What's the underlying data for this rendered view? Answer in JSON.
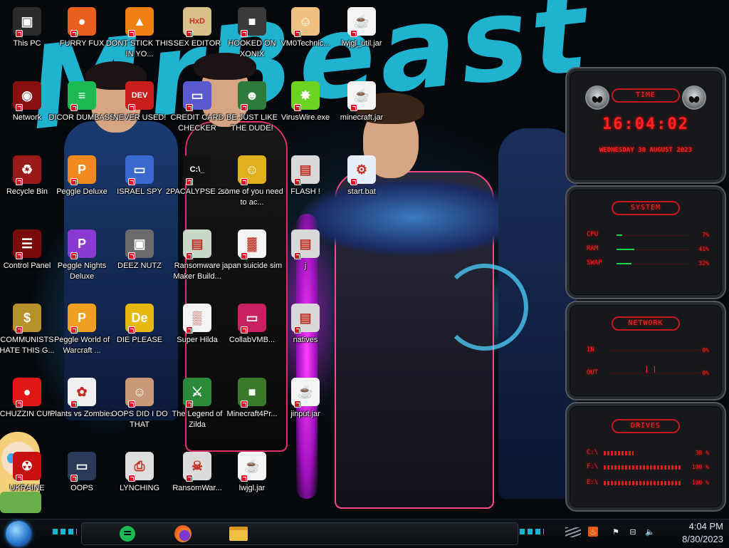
{
  "wallpaper": {
    "text": "MrBeast",
    "accent_color": "#22c6e6"
  },
  "desktop_icons": [
    {
      "label": "This PC",
      "icon": "this-pc-icon",
      "color": "#2a2a2a",
      "glyph": "▣"
    },
    {
      "label": "FURRY FUX",
      "icon": "firefox-icon",
      "color": "#e8601c",
      "glyph": "●"
    },
    {
      "label": "DONT STICK THIS IN YO...",
      "icon": "vlc-cone-icon",
      "color": "#f08010",
      "glyph": "▲"
    },
    {
      "label": "SEX EDITOR",
      "icon": "hxd-icon",
      "color": "#d9c08a",
      "glyph": "HxD"
    },
    {
      "label": "HOOKED ON XONIX",
      "icon": "xonix-icon",
      "color": "#3a3a3a",
      "glyph": "■"
    },
    {
      "label": "VM0Technic...",
      "icon": "doctor-icon",
      "color": "#f0c080",
      "glyph": "☺"
    },
    {
      "label": "lwjgl_util.jar",
      "icon": "java-jar-icon",
      "color": "#f4f4f4",
      "glyph": "☕"
    },
    {
      "label": "Network",
      "icon": "network-icon",
      "color": "#8a1010",
      "glyph": "◉"
    },
    {
      "label": "DICOR DUMBASS",
      "icon": "chat-icon",
      "color": "#1db954",
      "glyph": "≡"
    },
    {
      "label": "NEVER USED!",
      "icon": "devcpp-icon",
      "color": "#c81e1e",
      "glyph": "DEV"
    },
    {
      "label": "CREDIT CARD CHECKER",
      "icon": "credit-card-icon",
      "color": "#5a5ad0",
      "glyph": "▭"
    },
    {
      "label": "BE JUST LIKE THE DUDE!",
      "icon": "santa-icon",
      "color": "#2e7a3a",
      "glyph": "☻"
    },
    {
      "label": "VirusWire.exe",
      "icon": "lime-icon",
      "color": "#6ad420",
      "glyph": "✸"
    },
    {
      "label": "minecraft.jar",
      "icon": "java-jar-icon",
      "color": "#f4f4f4",
      "glyph": "☕"
    },
    {
      "label": "Recycle Bin",
      "icon": "recycle-bin-icon",
      "color": "#9a1a1a",
      "glyph": "♻"
    },
    {
      "label": "Peggle Deluxe",
      "icon": "peggle-icon",
      "color": "#f08a1e",
      "glyph": "P"
    },
    {
      "label": "ISRAEL SPY",
      "icon": "monitor-icon",
      "color": "#3a6ad0",
      "glyph": "▭"
    },
    {
      "label": "2PACALYPSE 2.3",
      "icon": "terminal-icon",
      "color": "#111111",
      "glyph": "C:\\_"
    },
    {
      "label": "some of you need to ac...",
      "icon": "beaver-icon",
      "color": "#e0b020",
      "glyph": "☺"
    },
    {
      "label": "FLASH !",
      "icon": "folder-icon",
      "color": "#d8d8d8",
      "glyph": "▤"
    },
    {
      "label": "start.bat",
      "icon": "batch-gear-icon",
      "color": "#e8eef8",
      "glyph": "⚙"
    },
    {
      "label": "Control Panel",
      "icon": "control-panel-icon",
      "color": "#7a0a0a",
      "glyph": "☰"
    },
    {
      "label": "Peggle Nights Deluxe",
      "icon": "peggle-icon",
      "color": "#8a3ad0",
      "glyph": "P"
    },
    {
      "label": "DEEZ NUTZ",
      "icon": "windows-stack-icon",
      "color": "#6a6a6a",
      "glyph": "▣"
    },
    {
      "label": "Ransomware Maker Build...",
      "icon": "app-window-icon",
      "color": "#c8d8c8",
      "glyph": "▤"
    },
    {
      "label": "japan suicide sim",
      "icon": "document-icon",
      "color": "#f4f4f4",
      "glyph": "▓"
    },
    {
      "label": "j",
      "icon": "folder-icon",
      "color": "#d8d8d8",
      "glyph": "▤"
    },
    {
      "label": "COMMUNISTS HATE THIS G...",
      "icon": "money-bag-icon",
      "color": "#b8902a",
      "glyph": "$"
    },
    {
      "label": "Peggle World of Warcraft ...",
      "icon": "peggle-icon",
      "color": "#f0a020",
      "glyph": "P"
    },
    {
      "label": "DIE PLEASE",
      "icon": "de-icon",
      "color": "#e8b810",
      "glyph": "De"
    },
    {
      "label": "Super Hilda",
      "icon": "pixel-dog-icon",
      "color": "#f4f4f4",
      "glyph": "▒"
    },
    {
      "label": "CollabVMB...",
      "icon": "vm-screen-icon",
      "color": "#c82060",
      "glyph": "▭"
    },
    {
      "label": "natives",
      "icon": "folder-icon",
      "color": "#d8d8d8",
      "glyph": "▤"
    },
    {
      "label": "CHUZZIN CUM",
      "icon": "chuzzle-icon",
      "color": "#e01818",
      "glyph": "●"
    },
    {
      "label": "Plants vs Zombies",
      "icon": "flower-icon",
      "color": "#f0f0f0",
      "glyph": "✿"
    },
    {
      "label": "OOPS DID I DO THAT",
      "icon": "portrait-icon",
      "color": "#c89878",
      "glyph": "☺"
    },
    {
      "label": "The Legend of Zilda",
      "icon": "zelda-icon",
      "color": "#2a8a3a",
      "glyph": "⚔"
    },
    {
      "label": "Minecraft4Pr...",
      "icon": "grass-block-icon",
      "color": "#3a7a2a",
      "glyph": "■"
    },
    {
      "label": "jinput.jar",
      "icon": "java-jar-icon",
      "color": "#f4f4f4",
      "glyph": "☕"
    },
    {
      "label": "UKRAINE",
      "icon": "radiation-icon",
      "color": "#c81010",
      "glyph": "☢"
    },
    {
      "label": "OOPS",
      "icon": "screen-icon",
      "color": "#2a3a5a",
      "glyph": "▭"
    },
    {
      "label": "LYNCHING",
      "icon": "rope-icon",
      "color": "#dddddd",
      "glyph": "⎙"
    },
    {
      "label": "RansomWar...",
      "icon": "skull-icon",
      "color": "#dcdcdc",
      "glyph": "☠"
    },
    {
      "label": "lwjgl.jar",
      "icon": "java-jar-icon",
      "color": "#f4f4f4",
      "glyph": "☕"
    }
  ],
  "gadget": {
    "time": {
      "title": "TIME",
      "clock": "16:04:02",
      "date": "WEDNESDAY 30 AUGUST 2023"
    },
    "system": {
      "title": "SYSTEM",
      "rows": [
        {
          "label": "CPU",
          "value": "7%",
          "level": 0.07
        },
        {
          "label": "RAM",
          "value": "41%",
          "level": 0.41
        },
        {
          "label": "SWAP",
          "value": "32%",
          "level": 0.32
        }
      ]
    },
    "network": {
      "title": "NETWORK",
      "rows": [
        {
          "label": "IN",
          "value": "0%"
        },
        {
          "label": "OUT",
          "value": "0%"
        }
      ]
    },
    "drives": {
      "title": "DRIVES",
      "rows": [
        {
          "label": "C:\\",
          "value": "38 %",
          "level": 0.38
        },
        {
          "label": "F:\\",
          "value": "100 %",
          "level": 1.0
        },
        {
          "label": "E:\\",
          "value": "100 %",
          "level": 1.0
        }
      ]
    },
    "accent_color": "#ff2222"
  },
  "taskbar": {
    "pinned": [
      {
        "name": "chat-app",
        "icon": "chat-icon",
        "color": "#1db954"
      },
      {
        "name": "firefox",
        "icon": "firefox-icon",
        "color": "#e8601c"
      },
      {
        "name": "file-explorer",
        "icon": "folder-icon",
        "color": "#f0c040"
      }
    ],
    "tray": {
      "time": "4:04 PM",
      "date": "8/30/2023"
    }
  }
}
